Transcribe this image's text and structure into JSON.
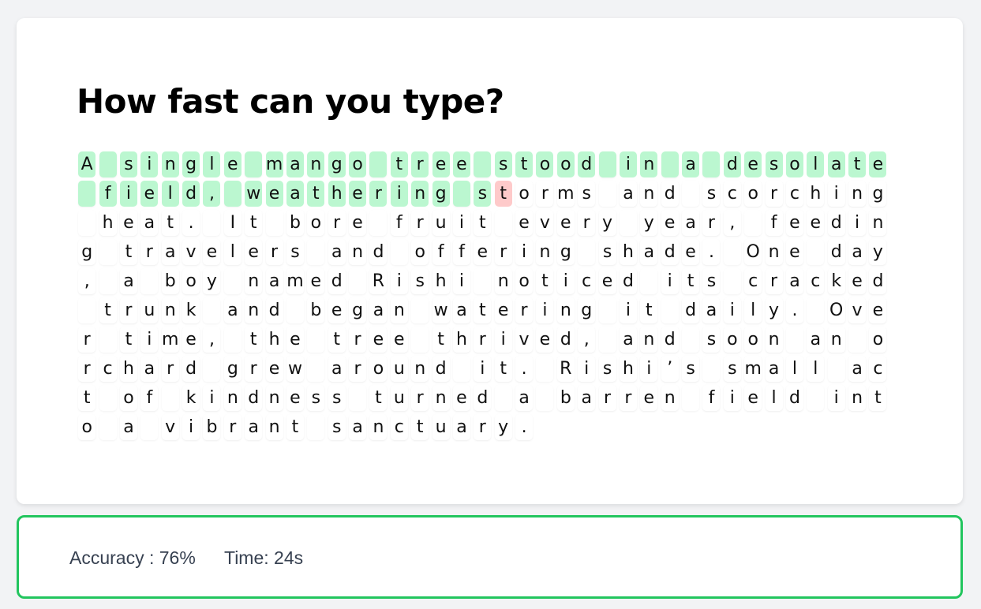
{
  "title": "How fast can you type?",
  "passage": "A single mango tree stood in a desolate field, weathering storms and scorching heat. It bore fruit every year, feeding travelers and offering shade. One day, a boy named Rishi noticed its cracked trunk and began watering it daily. Over time, the tree thrived, and soon an orchard grew around it. Rishi’s small act of kindness turned a barren field into a vibrant sanctuary.",
  "typed_correct_count": 59,
  "incorrect_indices": [
    59
  ],
  "stats": {
    "accuracy_label": "Accuracy : 76%",
    "time_label": "Time: 24s"
  },
  "colors": {
    "correct": "#bbf7d0",
    "incorrect": "#fecaca",
    "stats_border": "#22c55e"
  }
}
